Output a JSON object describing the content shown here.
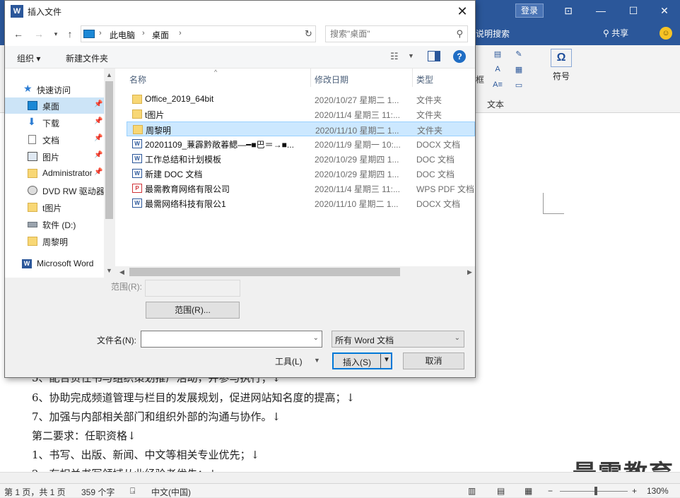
{
  "word": {
    "login_label": "登录",
    "tell_me_label": "说明搜索",
    "share_label": "共享",
    "ribbon_frame_label": "框",
    "ribbon_text_group_label": "文本",
    "ribbon_symbol_label": "符号",
    "ribbon_symbol_glyph": "Ω",
    "doc_lines": [
      "5、配合负任书与组织策划推广活动，并参与执行；↓",
      "6、协助完成频道管理与栏目的发展规划，促进网站知名度的提高；↓",
      "7、加强与内部相关部门和组织外部的沟通与协作。↓",
      "第二要求：任职资格↓",
      "1、书写、出版、新闻、中文等相关专业优先；↓",
      "2、有相关书写领域从业经验者优先；↓"
    ],
    "watermark": "最需教育",
    "status": {
      "page": "第 1 页，共 1 页",
      "words": "359 个字",
      "language": "中文(中国)",
      "zoom": "130%",
      "zoom_minus": "−",
      "zoom_plus": "+"
    }
  },
  "dialog": {
    "icon_letter": "W",
    "title": "插入文件",
    "close_glyph": "✕",
    "address": {
      "segments": [
        "此电脑",
        "桌面"
      ]
    },
    "search": {
      "placeholder": "搜索\"桌面\""
    },
    "cmdbar": {
      "organize_label": "组织 ▾",
      "new_folder_label": "新建文件夹",
      "help_glyph": "?"
    },
    "nav_items": [
      {
        "label": "快速访问",
        "icon": "star-icon",
        "pinned": false,
        "selected": false
      },
      {
        "label": "桌面",
        "icon": "desktop-icon",
        "pinned": true,
        "selected": true
      },
      {
        "label": "下载",
        "icon": "download-icon",
        "pinned": true,
        "selected": false
      },
      {
        "label": "文档",
        "icon": "document-icon",
        "pinned": true,
        "selected": false
      },
      {
        "label": "图片",
        "icon": "pictures-icon",
        "pinned": true,
        "selected": false
      },
      {
        "label": "Administrator",
        "icon": "folder-icon",
        "pinned": true,
        "selected": false
      },
      {
        "label": "DVD RW 驱动器",
        "icon": "dvd-drive-icon",
        "pinned": false,
        "selected": false
      },
      {
        "label": "t图片",
        "icon": "folder-icon",
        "pinned": false,
        "selected": false
      },
      {
        "label": "软件 (D:)",
        "icon": "drive-icon",
        "pinned": false,
        "selected": false
      },
      {
        "label": "周黎明",
        "icon": "folder-icon",
        "pinned": false,
        "selected": false
      },
      {
        "label": "Microsoft Word",
        "icon": "word-icon",
        "pinned": false,
        "selected": false
      }
    ],
    "columns": {
      "name": "名称",
      "date": "修改日期",
      "type": "类型"
    },
    "files": [
      {
        "name": "Office_2019_64bit",
        "date": "2020/10/27 星期二 1...",
        "type": "文件夹",
        "icon": "folder-icon",
        "selected": false
      },
      {
        "name": "t图片",
        "date": "2020/11/4 星期三 11:...",
        "type": "文件夹",
        "icon": "folder-icon",
        "selected": false
      },
      {
        "name": "周黎明",
        "date": "2020/11/10 星期二 1...",
        "type": "文件夹",
        "icon": "folder-icon",
        "selected": true
      },
      {
        "name": "20201109_蒹霹黔敞萶鳃—━■巴＝→■...",
        "date": "2020/11/9 星期一 10:...",
        "type": "DOCX 文档",
        "icon": "docx-icon",
        "selected": false
      },
      {
        "name": "工作总结和计划模板",
        "date": "2020/10/29 星期四 1...",
        "type": "DOC 文档",
        "icon": "doc-icon",
        "selected": false
      },
      {
        "name": "新建 DOC 文档",
        "date": "2020/10/29 星期四 1...",
        "type": "DOC 文档",
        "icon": "doc-icon",
        "selected": false
      },
      {
        "name": "最需教育网络有限公司",
        "date": "2020/11/4 星期三 11:...",
        "type": "WPS PDF 文档",
        "icon": "pdf-icon",
        "selected": false
      },
      {
        "name": "最需网络科技有限公1",
        "date": "2020/11/10 星期二 1...",
        "type": "DOCX 文档",
        "icon": "docx-icon",
        "selected": false
      }
    ],
    "range_label": "范围(R):",
    "range_button_label": "范围(R)...",
    "filename_label": "文件名(N):",
    "filename_value": "",
    "filetype_value": "所有 Word 文档",
    "tools_label": "工具(L)",
    "insert_label": "插入(S)",
    "cancel_label": "取消"
  }
}
